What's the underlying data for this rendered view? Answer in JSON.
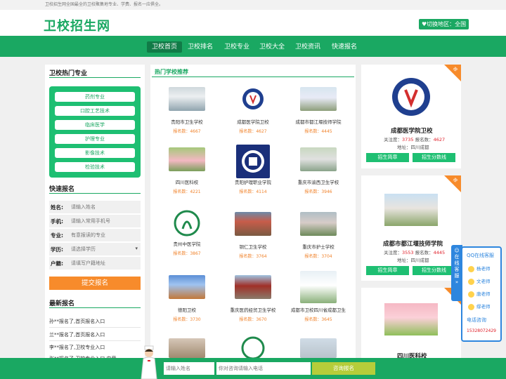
{
  "topbar": {
    "text": "卫校招生网全国最全的卫校聚集地专业、学费、报名一应俱全。"
  },
  "header": {
    "logo": "卫校招生网",
    "region_label": "切换地区：全国"
  },
  "nav": {
    "items": [
      "卫校首页",
      "卫校排名",
      "卫校专业",
      "卫校大全",
      "卫校资讯",
      "快速报名"
    ],
    "active_index": 0
  },
  "majors": {
    "title": "卫校热门专业",
    "items": [
      "药剂专业",
      "口腔工艺技术",
      "临床医学",
      "护理专业",
      "影像技术",
      "检验技术"
    ]
  },
  "quick_signup": {
    "title": "快速报名",
    "fields": [
      {
        "label": "姓名:",
        "placeholder": "请输入姓名"
      },
      {
        "label": "手机:",
        "placeholder": "请输入常用手机号"
      },
      {
        "label": "专业:",
        "placeholder": "有意报读的专业"
      },
      {
        "label": "学历:",
        "placeholder": "请选择学历"
      },
      {
        "label": "户籍:",
        "placeholder": "请填写户籍地址"
      }
    ],
    "submit": "提交报名"
  },
  "recent": {
    "title": "最新报名",
    "items": [
      "孙**报名了,首页报名入口",
      "兰**报名了,首页报名入口",
      "李**报名了,卫校专业入口",
      "张**报名了,卫校专业入口 电音..."
    ]
  },
  "hot_schools": {
    "title": "热门学校推荐",
    "items": [
      {
        "name": "贵阳市卫生学校",
        "count": "报名数：4667"
      },
      {
        "name": "成都医学院卫校",
        "count": "报名数：4627"
      },
      {
        "name": "成都市都江堰技师学院",
        "count": "报名数：4445"
      },
      {
        "name": "四川医科校",
        "count": "报名数：4221"
      },
      {
        "name": "贵阳护理职业学院",
        "count": "报名数：4114"
      },
      {
        "name": "重庆市渝西卫生学校",
        "count": "报名数：3946"
      },
      {
        "name": "贵州中医学院",
        "count": "报名数：3867"
      },
      {
        "name": "铜仁卫生学校",
        "count": "报名数：3764"
      },
      {
        "name": "重庆市护士学校",
        "count": "报名数：3704"
      },
      {
        "name": "德阳卫校",
        "count": "报名数：3730"
      },
      {
        "name": "重庆医药经贸卫生学校",
        "count": "报名数：3670"
      },
      {
        "name": "成都市卫校四川省成都卫生",
        "count": "报名数：3645"
      }
    ]
  },
  "recommend": [
    {
      "badge": "荐",
      "name": "成都医学院卫校",
      "attention_label": "关注度：",
      "attention": "3735",
      "signup_label": "报名数：",
      "signup": "4627",
      "address": "地址：四川成都",
      "btn1": "招生简章",
      "btn2": "招生分数线"
    },
    {
      "badge": "荐",
      "name": "成都市都江堰技师学院",
      "attention_label": "关注度：",
      "attention": "3553",
      "signup_label": "报名数：",
      "signup": "4445",
      "address": "地址：四川成都",
      "btn1": "招生简章",
      "btn2": "招生分数线"
    },
    {
      "badge": "荐",
      "name": "四川医科校"
    }
  ],
  "qq_service": {
    "side_label": "在线客服",
    "title": "QQ在线客服",
    "agents": [
      "杨老师",
      "文老师",
      "唐老师",
      "缪老师"
    ],
    "phone_title": "电话咨询",
    "phone": "15328072429"
  },
  "bottom_bar": {
    "name_placeholder": "请输入姓名",
    "phone_placeholder": "你对咨询请输入电话",
    "button": "咨询报名"
  }
}
